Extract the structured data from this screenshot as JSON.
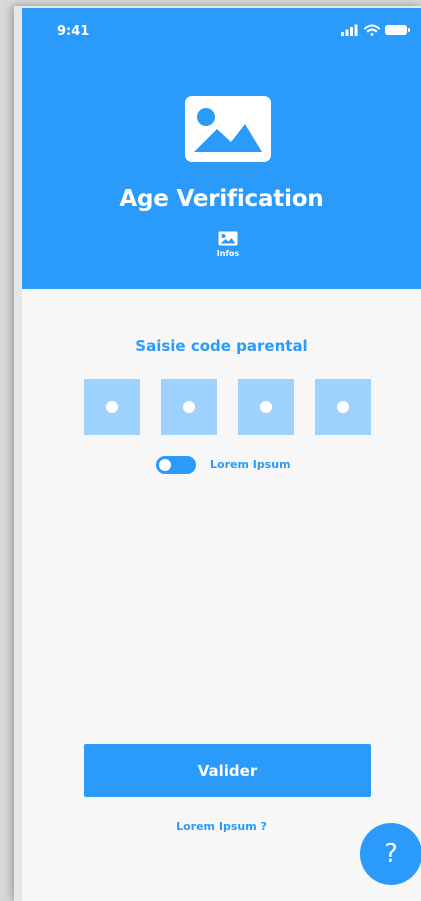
{
  "status_bar": {
    "time": "9:41",
    "icons": [
      "cellular-signal-icon",
      "wifi-icon",
      "battery-icon"
    ]
  },
  "header": {
    "image_icon": "image-placeholder-icon",
    "title": "Age Verification",
    "infos": {
      "icon": "image-icon",
      "label": "Infos"
    }
  },
  "main": {
    "section_title": "Saisie code parental",
    "code_inputs": [
      {
        "value": "•"
      },
      {
        "value": "•"
      },
      {
        "value": "•"
      },
      {
        "value": "•"
      }
    ],
    "toggle": {
      "label": "Lorem Ipsum",
      "on": false
    },
    "submit_label": "Valider",
    "secondary_link": "Lorem Ipsum ?",
    "help_button": "?"
  },
  "colors": {
    "primary": "#2b9bfb",
    "code_box": "#9fd1fd",
    "background": "#f7f7f7",
    "on_primary": "#ffffff"
  }
}
